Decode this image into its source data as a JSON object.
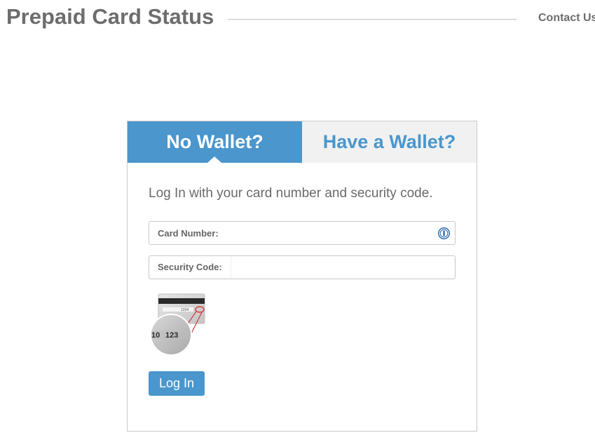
{
  "header": {
    "title": "Prepaid Card Status",
    "contact_label": "Contact Us"
  },
  "tabs": [
    {
      "label": "No Wallet?",
      "active": true
    },
    {
      "label": "Have a Wallet?",
      "active": false
    }
  ],
  "form": {
    "instructions": "Log In with your card number and security code.",
    "card_number": {
      "label": "Card Number:",
      "value": "",
      "placeholder": ""
    },
    "security_code": {
      "label": "Security Code:",
      "value": "",
      "placeholder": ""
    },
    "cvv_hint": {
      "left_digits": "10",
      "right_digits": "123"
    },
    "submit_label": "Log In"
  },
  "colors": {
    "accent": "#4a96cd",
    "inactive_tab_bg": "#f1f1f1",
    "title_gray": "#6d6d6d",
    "border": "#c9c9c9",
    "hint_circle_red": "#d9363e"
  },
  "icons": {
    "card_number_field": "password-manager-icon",
    "security_hint": "card-security-code-illustration"
  }
}
